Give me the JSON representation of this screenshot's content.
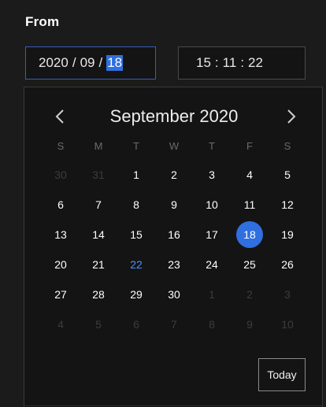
{
  "from_label": "From",
  "date_field": {
    "year": "2020",
    "month": "09",
    "day": "18",
    "separator": "/"
  },
  "time_field": {
    "hour": "15",
    "minute": "11",
    "second": "22",
    "separator": ":"
  },
  "calendar": {
    "month_title": "September 2020",
    "prev_icon": "chevron-left-icon",
    "next_icon": "chevron-right-icon",
    "weekdays": [
      "S",
      "M",
      "T",
      "W",
      "T",
      "F",
      "S"
    ],
    "weeks": [
      [
        "30",
        "31",
        "1",
        "2",
        "3",
        "4",
        "5"
      ],
      [
        "6",
        "7",
        "8",
        "9",
        "10",
        "11",
        "12"
      ],
      [
        "13",
        "14",
        "15",
        "16",
        "17",
        "18",
        "19"
      ],
      [
        "20",
        "21",
        "22",
        "23",
        "24",
        "25",
        "26"
      ],
      [
        "27",
        "28",
        "29",
        "30",
        "1",
        "2",
        "3"
      ],
      [
        "4",
        "5",
        "6",
        "7",
        "8",
        "9",
        "10"
      ]
    ],
    "selected_day": "18",
    "today_day": "22",
    "today_button": "Today"
  },
  "colors": {
    "background": "#1b1b1b",
    "accent": "#2f6fe0",
    "today_text": "#4f8ff7",
    "muted": "#3c3c3c"
  }
}
